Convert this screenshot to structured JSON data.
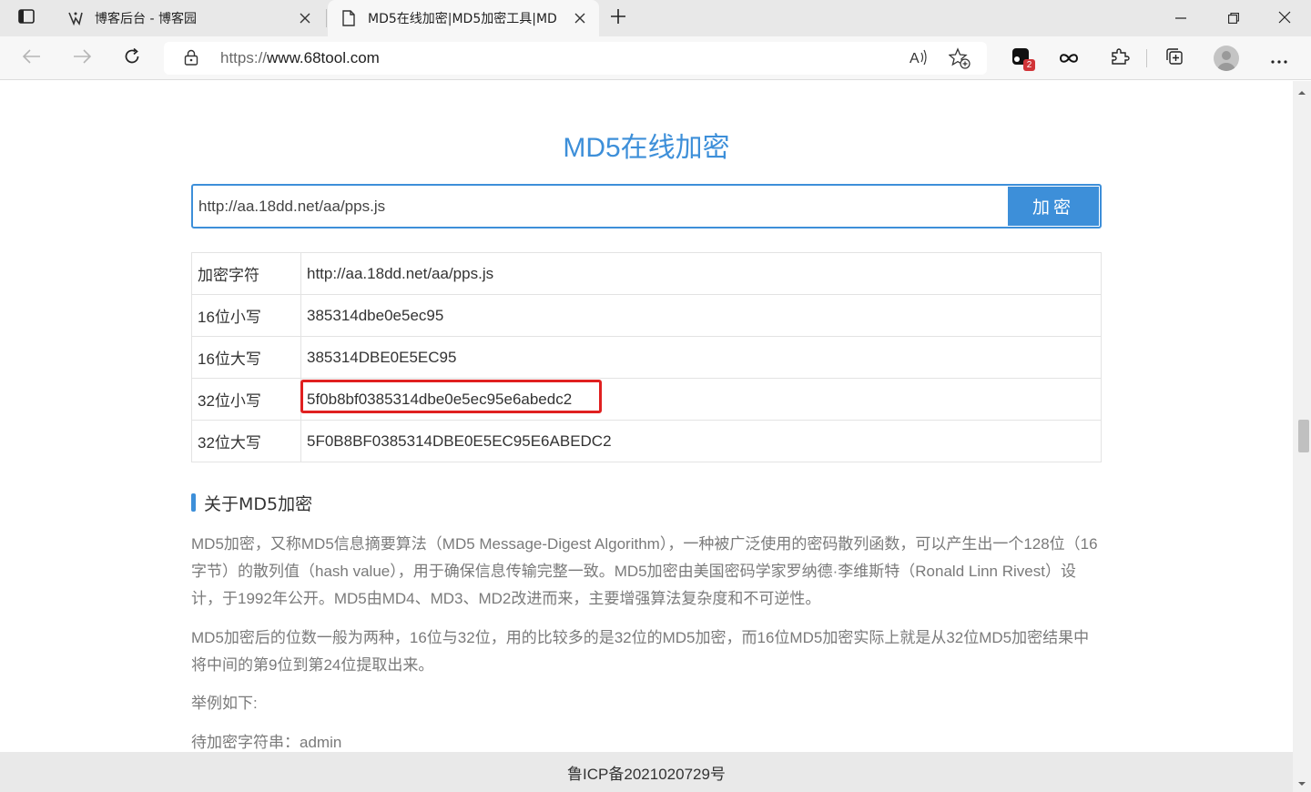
{
  "browser": {
    "tabs": [
      {
        "title": "博客后台 - 博客园",
        "active": false
      },
      {
        "title": "MD5在线加密|MD5加密工具|MD",
        "active": true
      }
    ],
    "address": {
      "scheme": "https://",
      "host": "www.68tool.com"
    },
    "extension_badge": "2",
    "icons": {
      "tab_actions": "tab-actions-icon",
      "back": "back-arrow-icon",
      "forward": "forward-arrow-icon",
      "refresh": "refresh-icon",
      "lock": "lock-icon",
      "read_aloud": "read-aloud-icon",
      "add_favorite": "add-favorite-icon",
      "extensions": "puzzle-icon",
      "collections": "collections-icon",
      "menu": "more-icon"
    }
  },
  "page": {
    "title": "MD5在线加密",
    "input_value": "http://aa.18dd.net/aa/pps.js",
    "button_label": "加密",
    "results": [
      {
        "label": "加密字符",
        "value": "http://aa.18dd.net/aa/pps.js"
      },
      {
        "label": "16位小写",
        "value": "385314dbe0e5ec95"
      },
      {
        "label": "16位大写",
        "value": "385314DBE0E5EC95"
      },
      {
        "label": "32位小写",
        "value": "5f0b8bf0385314dbe0e5ec95e6abedc2"
      },
      {
        "label": "32位大写",
        "value": "5F0B8BF0385314DBE0E5EC95E6ABEDC2"
      }
    ],
    "highlighted_row": 3,
    "section_title": "关于MD5加密",
    "paragraphs": [
      "MD5加密，又称MD5信息摘要算法（MD5 Message-Digest Algorithm），一种被广泛使用的密码散列函数，可以产生出一个128位（16字节）的散列值（hash value），用于确保信息传输完整一致。MD5加密由美国密码学家罗纳德·李维斯特（Ronald Linn Rivest）设计，于1992年公开。MD5由MD4、MD3、MD2改进而来，主要增强算法复杂度和不可逆性。",
      "MD5加密后的位数一般为两种，16位与32位，用的比较多的是32位的MD5加密，而16位MD5加密实际上就是从32位MD5加密结果中将中间的第9位到第24位提取出来。",
      "举例如下:",
      "待加密字符串：admin"
    ],
    "footer": "鲁ICP备2021020729号"
  },
  "colors": {
    "accent": "#3d8fd9",
    "highlight": "#e02020",
    "badge": "#d13438"
  }
}
